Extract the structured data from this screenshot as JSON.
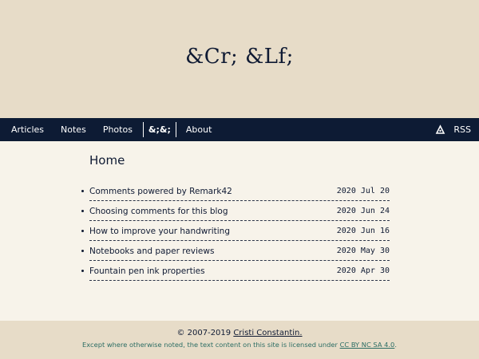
{
  "site": {
    "title": "&Cr; &Lf;"
  },
  "nav": {
    "items": [
      "Articles",
      "Notes",
      "Photos"
    ],
    "logo": "&;&;",
    "about": "About",
    "rss": "RSS"
  },
  "main": {
    "title": "Home",
    "posts": [
      {
        "title": "Comments powered by Remark42",
        "date": "2020 Jul 20"
      },
      {
        "title": "Choosing comments for this blog",
        "date": "2020 Jun 24"
      },
      {
        "title": "How to improve your handwriting",
        "date": "2020 Jun 16"
      },
      {
        "title": "Notebooks and paper reviews",
        "date": "2020 May 30"
      },
      {
        "title": "Fountain pen ink properties",
        "date": "2020 Apr 30"
      }
    ]
  },
  "footer": {
    "copyright_prefix": "© 2007-2019 ",
    "author": "Cristi Constantin.",
    "license_prefix": "Except where otherwise noted, the text content on this site is licensed under ",
    "license_name": "CC BY NC SA 4.0",
    "license_suffix": "."
  },
  "colors": {
    "header_bg": "#e7dcc8",
    "nav_bg": "#0d1b34",
    "page_bg": "#f7f3ea",
    "text": "#0f1a33",
    "license_text": "#2b6d64"
  }
}
